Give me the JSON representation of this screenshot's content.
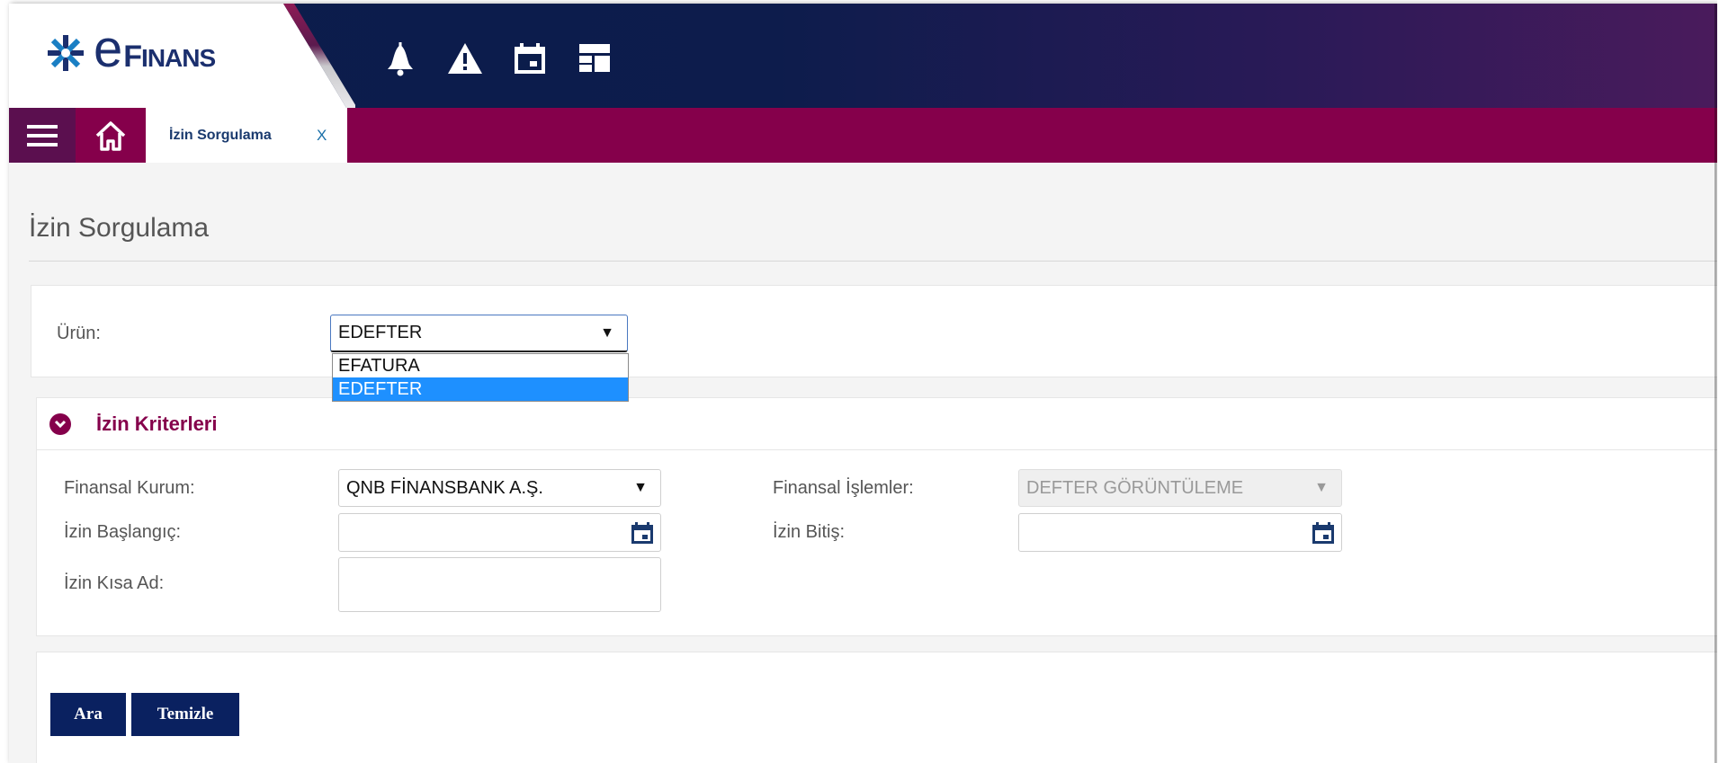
{
  "app": {
    "brand_prefix": "e",
    "brand_F": "F",
    "brand_rest": "INANS"
  },
  "header_icons": [
    "bell-icon",
    "warning-icon",
    "calendar-icon",
    "layout-icon"
  ],
  "nav": {
    "tab_label": "İzin Sorgulama",
    "tab_close": "X"
  },
  "page": {
    "title": "İzin Sorgulama"
  },
  "product": {
    "label": "Ürün:",
    "selected": "EDEFTER",
    "options": [
      "EFATURA",
      "EDEFTER"
    ]
  },
  "criteria": {
    "title": "İzin Kriterleri",
    "finansal_kurum_label": "Finansal Kurum:",
    "finansal_kurum_value": "QNB FİNANSBANK A.Ş.",
    "finansal_islemler_label": "Finansal İşlemler:",
    "finansal_islemler_value": "DEFTER GÖRÜNTÜLEME",
    "izin_baslangic_label": "İzin Başlangıç:",
    "izin_baslangic_value": "",
    "izin_bitis_label": "İzin Bitiş:",
    "izin_bitis_value": "",
    "izin_kisa_ad_label": "İzin Kısa Ad:",
    "izin_kisa_ad_value": ""
  },
  "actions": {
    "search_label": "Ara",
    "clear_label": "Temizle"
  },
  "colors": {
    "brand_navy": "#0b1d4b",
    "brand_magenta": "#85004b",
    "button_bg": "#0a2160",
    "selected_option": "#1e90ff"
  }
}
